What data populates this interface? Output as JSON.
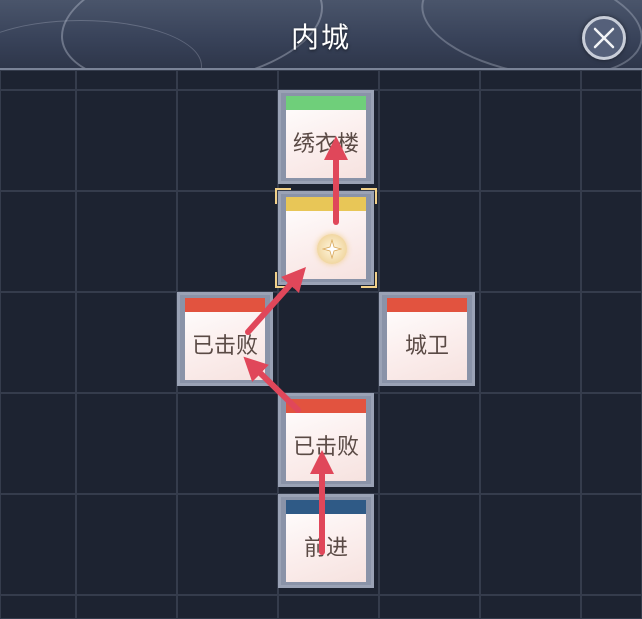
{
  "header": {
    "title": "内城"
  },
  "tiles": [
    {
      "label": "绣衣楼",
      "bar_color": "#6fcf7a"
    },
    {
      "label": "",
      "bar_color": "#e8c657",
      "icon": "compass-star-icon"
    },
    {
      "label": "已击败",
      "bar_color": "#e2533f"
    },
    {
      "label": "城卫",
      "bar_color": "#e2533f"
    },
    {
      "label": "已击败",
      "bar_color": "#e2533f"
    },
    {
      "label": "前进",
      "bar_color": "#2f5a86"
    }
  ],
  "colors": {
    "arrow": "#e0475a",
    "selection": "#f2d18a"
  }
}
